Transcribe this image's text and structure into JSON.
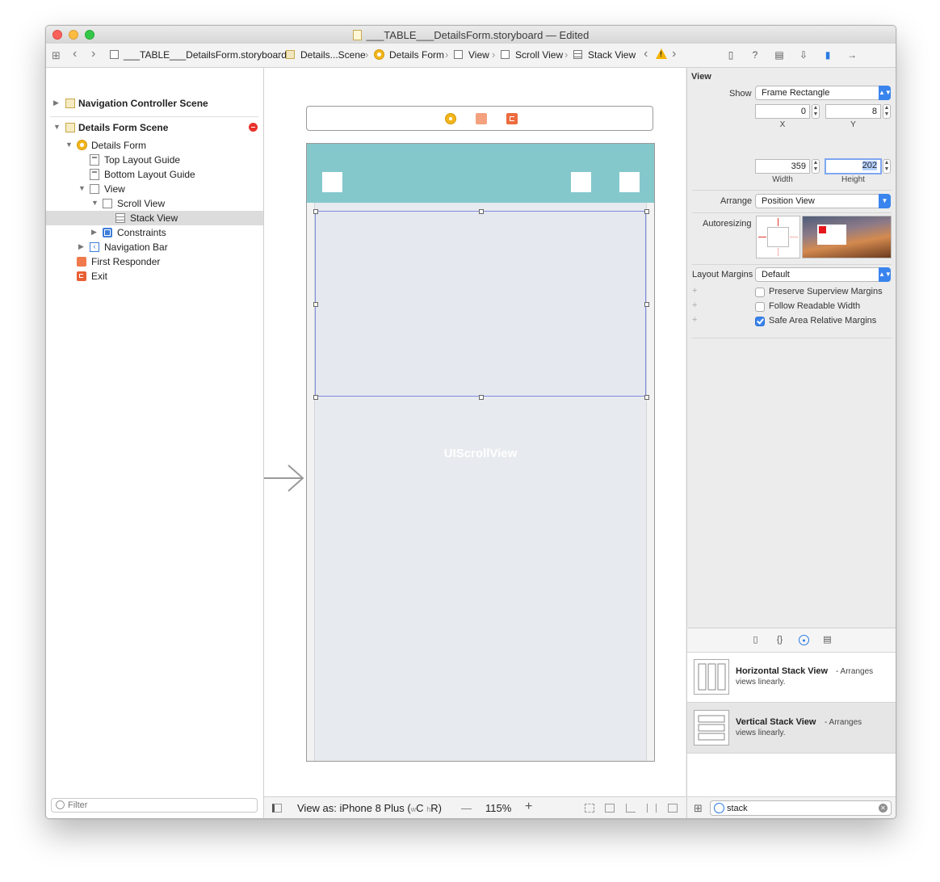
{
  "window": {
    "title": "___TABLE___DetailsForm.storyboard — Edited"
  },
  "jumpbar": {
    "crumbs": [
      "___TABLE___DetailsForm.storyboard",
      "Details...Scene",
      "Details Form",
      "View",
      "Scroll View",
      "Stack View"
    ]
  },
  "navigator": {
    "items": [
      {
        "label": "Navigation Controller Scene",
        "bold": true
      },
      {
        "label": "Details Form Scene",
        "bold": true
      },
      {
        "label": "Details Form"
      },
      {
        "label": "Top Layout Guide"
      },
      {
        "label": "Bottom Layout Guide"
      },
      {
        "label": "View"
      },
      {
        "label": "Scroll View"
      },
      {
        "label": "Stack View",
        "selected": true
      },
      {
        "label": "Constraints"
      },
      {
        "label": "Navigation Bar"
      },
      {
        "label": "First Responder"
      },
      {
        "label": "Exit"
      }
    ],
    "filter_placeholder": "Filter"
  },
  "canvas": {
    "scroll_view_label": "UIScrollView",
    "view_as": "View as: iPhone 8 Plus (",
    "size_class_w": "w",
    "size_class_c": "C",
    "size_class_h": "h",
    "size_class_r": "R)",
    "zoom_minus": "—",
    "zoom": "115%",
    "zoom_plus": "+",
    "nav_bar_color": "#84c8cc"
  },
  "inspector": {
    "section_title": "View",
    "show_label": "Show",
    "show_value": "Frame Rectangle",
    "x_value": "0",
    "y_value": "8",
    "x_label": "X",
    "y_label": "Y",
    "width_value": "359",
    "height_value": "202",
    "width_label": "Width",
    "height_label": "Height",
    "arrange_label": "Arrange",
    "arrange_value": "Position View",
    "autoresizing_label": "Autoresizing",
    "layout_margins_label": "Layout Margins",
    "layout_margins_value": "Default",
    "checkboxes": [
      {
        "label": "Preserve Superview Margins",
        "checked": false
      },
      {
        "label": "Follow Readable Width",
        "checked": false
      },
      {
        "label": "Safe Area Relative Margins",
        "checked": true
      }
    ]
  },
  "library": {
    "items": [
      {
        "title": "Horizontal Stack View",
        "desc": " - Arranges",
        "desc2": "views linearly."
      },
      {
        "title": "Vertical Stack View",
        "desc": " - Arranges",
        "desc2": "views linearly."
      }
    ],
    "search_value": "stack"
  },
  "colors": {
    "accent": "#3a84ed",
    "error": "#e8322b",
    "selection": "#7f8be0"
  }
}
